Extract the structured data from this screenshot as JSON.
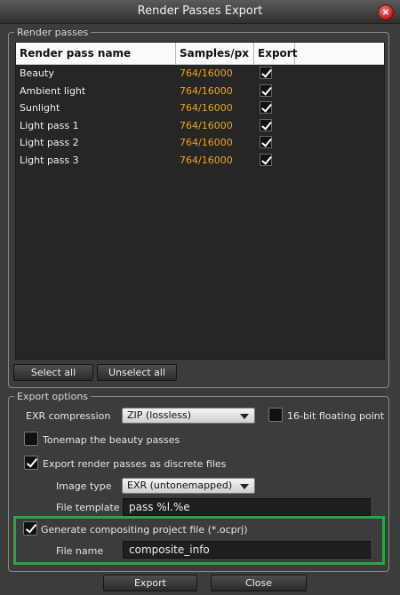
{
  "window": {
    "title": "Render Passes Export",
    "close_glyph": "×"
  },
  "render_passes": {
    "group_label": "Render passes",
    "columns": [
      "Render pass name",
      "Samples/px",
      "Export"
    ],
    "rows": [
      {
        "name": "Beauty",
        "samples": "764/16000",
        "export": true
      },
      {
        "name": "Ambient light",
        "samples": "764/16000",
        "export": true
      },
      {
        "name": "Sunlight",
        "samples": "764/16000",
        "export": true
      },
      {
        "name": "Light pass 1",
        "samples": "764/16000",
        "export": true
      },
      {
        "name": "Light pass 2",
        "samples": "764/16000",
        "export": true
      },
      {
        "name": "Light pass 3",
        "samples": "764/16000",
        "export": true
      }
    ],
    "select_all_label": "Select all",
    "unselect_all_label": "Unselect all",
    "samples_color": "#f5a31a"
  },
  "export_options": {
    "group_label": "Export options",
    "exr_compression_label": "EXR compression",
    "exr_compression_value": "ZIP (lossless)",
    "float16_label": "16-bit floating point",
    "float16_checked": false,
    "tonemap_label": "Tonemap the beauty passes",
    "tonemap_checked": false,
    "discrete_label": "Export render passes as discrete files",
    "discrete_checked": true,
    "image_type_label": "Image type",
    "image_type_value": "EXR (untonemapped)",
    "file_template_label": "File template",
    "file_template_value": "pass %l.%e",
    "compositing_label": "Generate compositing project file (*.ocprj)",
    "compositing_checked": true,
    "file_name_label": "File name",
    "file_name_value": "composite_info",
    "highlight_color": "#28a745"
  },
  "footer": {
    "export_label": "Export",
    "close_label": "Close"
  }
}
